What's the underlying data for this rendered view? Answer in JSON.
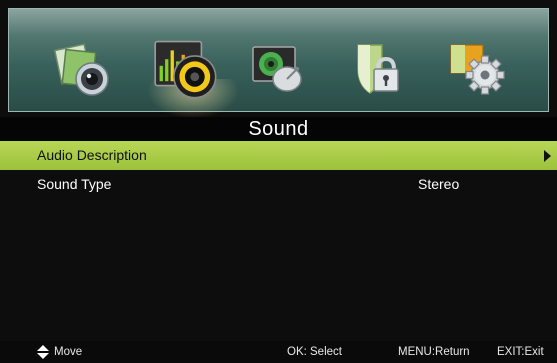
{
  "menu": {
    "icons": [
      {
        "name": "picture-icon",
        "selected": false
      },
      {
        "name": "sound-icon",
        "selected": true
      },
      {
        "name": "channel-icon",
        "selected": false
      },
      {
        "name": "lock-icon",
        "selected": false
      },
      {
        "name": "setup-icon",
        "selected": false
      }
    ],
    "title": "Sound",
    "items": [
      {
        "label": "Audio Description",
        "value": "",
        "highlighted": true
      },
      {
        "label": "Sound Type",
        "value": "Stereo",
        "highlighted": false
      }
    ]
  },
  "footer": {
    "move": "Move",
    "select": "OK: Select",
    "return": "MENU:Return",
    "exit": "EXIT:Exit"
  },
  "colors": {
    "highlight": "#a9cc45",
    "icon_bar": "#39615b",
    "background": "#0d0d0d"
  }
}
